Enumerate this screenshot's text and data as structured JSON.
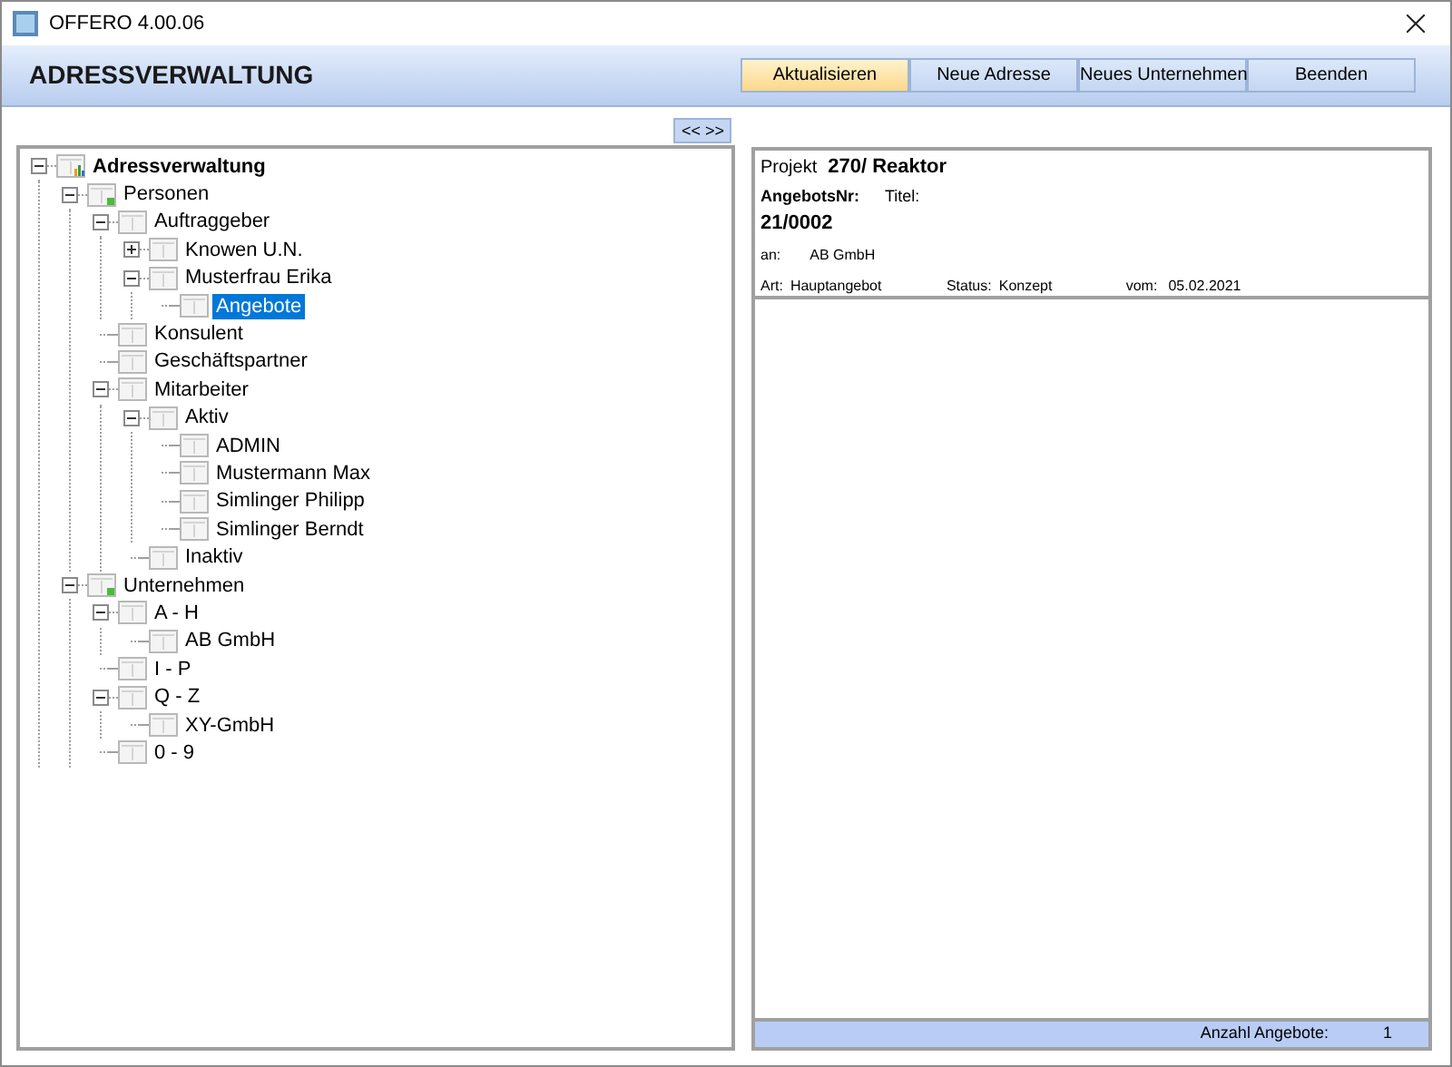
{
  "window": {
    "title": "OFFERO 4.00.06"
  },
  "header": {
    "title": "ADRESSVERWALTUNG"
  },
  "toolbar": [
    {
      "label": "Aktualisieren",
      "selected": true
    },
    {
      "label": "Neue Adresse",
      "selected": false
    },
    {
      "label": "Neues Unternehmen",
      "selected": false
    },
    {
      "label": "Beenden",
      "selected": false
    }
  ],
  "toggle_button": "<< >>",
  "tree": [
    {
      "label": "Adressverwaltung",
      "kind": "root",
      "expanded": true,
      "selected": false,
      "children": [
        {
          "label": "Personen",
          "kind": "group",
          "expanded": true,
          "selected": false,
          "children": [
            {
              "label": "Auftraggeber",
              "kind": "item",
              "expanded": true,
              "selected": false,
              "children": [
                {
                  "label": "Knowen U.N.",
                  "kind": "item",
                  "expanded": false,
                  "selected": false
                },
                {
                  "label": "Musterfrau Erika",
                  "kind": "item",
                  "expanded": true,
                  "selected": false,
                  "children": [
                    {
                      "label": "Angebote",
                      "kind": "item",
                      "selected": true
                    }
                  ]
                }
              ]
            },
            {
              "label": "Konsulent",
              "kind": "item",
              "selected": false
            },
            {
              "label": "Geschäftspartner",
              "kind": "item",
              "selected": false
            },
            {
              "label": "Mitarbeiter",
              "kind": "item",
              "expanded": true,
              "selected": false,
              "children": [
                {
                  "label": "Aktiv",
                  "kind": "item",
                  "expanded": true,
                  "selected": false,
                  "children": [
                    {
                      "label": "ADMIN",
                      "kind": "item",
                      "selected": false
                    },
                    {
                      "label": "Mustermann Max",
                      "kind": "item",
                      "selected": false
                    },
                    {
                      "label": "Simlinger Philipp",
                      "kind": "item",
                      "selected": false
                    },
                    {
                      "label": "Simlinger Berndt",
                      "kind": "item",
                      "selected": false
                    }
                  ]
                },
                {
                  "label": "Inaktiv",
                  "kind": "item",
                  "selected": false
                }
              ]
            }
          ]
        },
        {
          "label": "Unternehmen",
          "kind": "group",
          "expanded": true,
          "selected": false,
          "children": [
            {
              "label": "A - H",
              "kind": "item",
              "expanded": true,
              "selected": false,
              "children": [
                {
                  "label": "AB GmbH",
                  "kind": "item",
                  "selected": false
                }
              ]
            },
            {
              "label": "I - P",
              "kind": "item",
              "selected": false
            },
            {
              "label": "Q - Z",
              "kind": "item",
              "expanded": true,
              "selected": false,
              "children": [
                {
                  "label": "XY-GmbH",
                  "kind": "item",
                  "selected": false
                }
              ]
            },
            {
              "label": "0 - 9",
              "kind": "item",
              "selected": false
            }
          ]
        }
      ]
    }
  ],
  "offer": {
    "project_label": "Projekt",
    "project": "270/ Reaktor",
    "number_label": "AngebotsNr:",
    "title_label": "Titel:",
    "number": "21/0002",
    "to_label": "an:",
    "to": "AB GmbH",
    "type_label": "Art:",
    "type": "Hauptangebot",
    "status_label": "Status:",
    "status": "Konzept",
    "date_label": "vom:",
    "date": "05.02.2021"
  },
  "footer": {
    "count_label": "Anzahl Angebote:",
    "count": "1"
  }
}
